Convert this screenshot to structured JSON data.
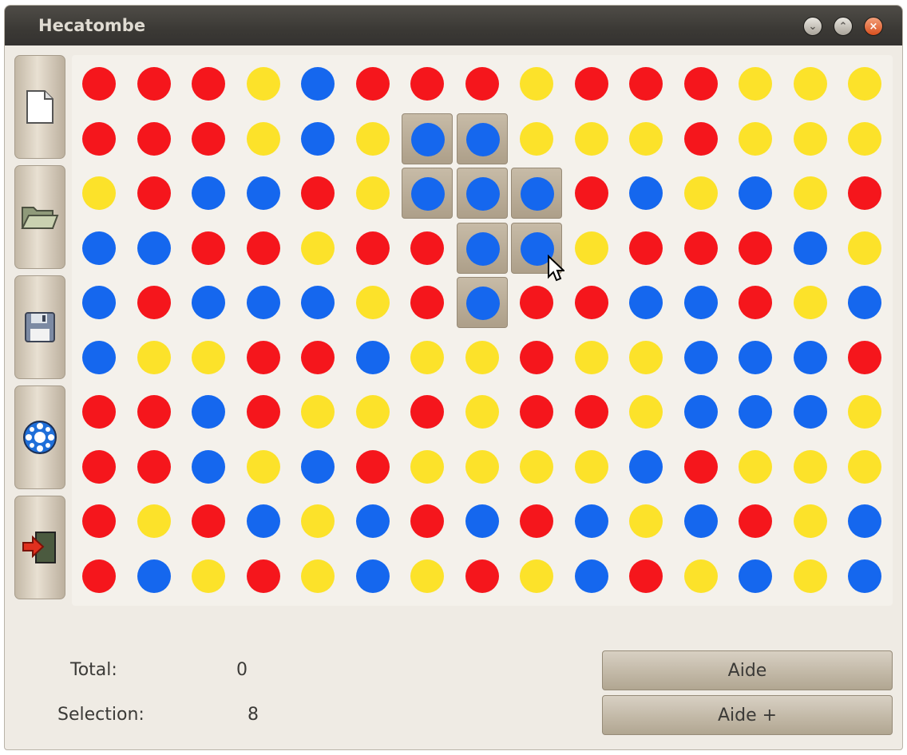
{
  "window": {
    "title": "Hecatombe"
  },
  "colors": {
    "red": "#f5161c",
    "blue": "#1567ee",
    "yellow": "#fce22a"
  },
  "toolbar": {
    "items": [
      "new-file-icon",
      "open-folder-icon",
      "save-floppy-icon",
      "settings-icon",
      "exit-icon"
    ]
  },
  "board": {
    "rows": [
      "RRRYBRRRYRRRYYY",
      "RRRYBYBBYYYRYYY",
      "YRBBRYBBBRBYBYR",
      "BBRRYRRBBYRRRBY",
      "BRBBBYRBRRBBRYB",
      "BYYRRBYYRYYBBBR",
      "RRBRYYRYRRYBBBY",
      "RRBYBRYYYYBRYYY",
      "RYRBYBRBRBYBRYB",
      "RBYRYBYRYBRYBYB"
    ],
    "selected": [
      [
        1,
        6
      ],
      [
        1,
        7
      ],
      [
        2,
        6
      ],
      [
        2,
        7
      ],
      [
        2,
        8
      ],
      [
        3,
        7
      ],
      [
        3,
        8
      ],
      [
        4,
        7
      ]
    ]
  },
  "status": {
    "total_label": "Total:",
    "total_value": "0",
    "selection_label": "Selection:",
    "selection_value": "8"
  },
  "buttons": {
    "help": "Aide",
    "help_plus": "Aide +"
  }
}
